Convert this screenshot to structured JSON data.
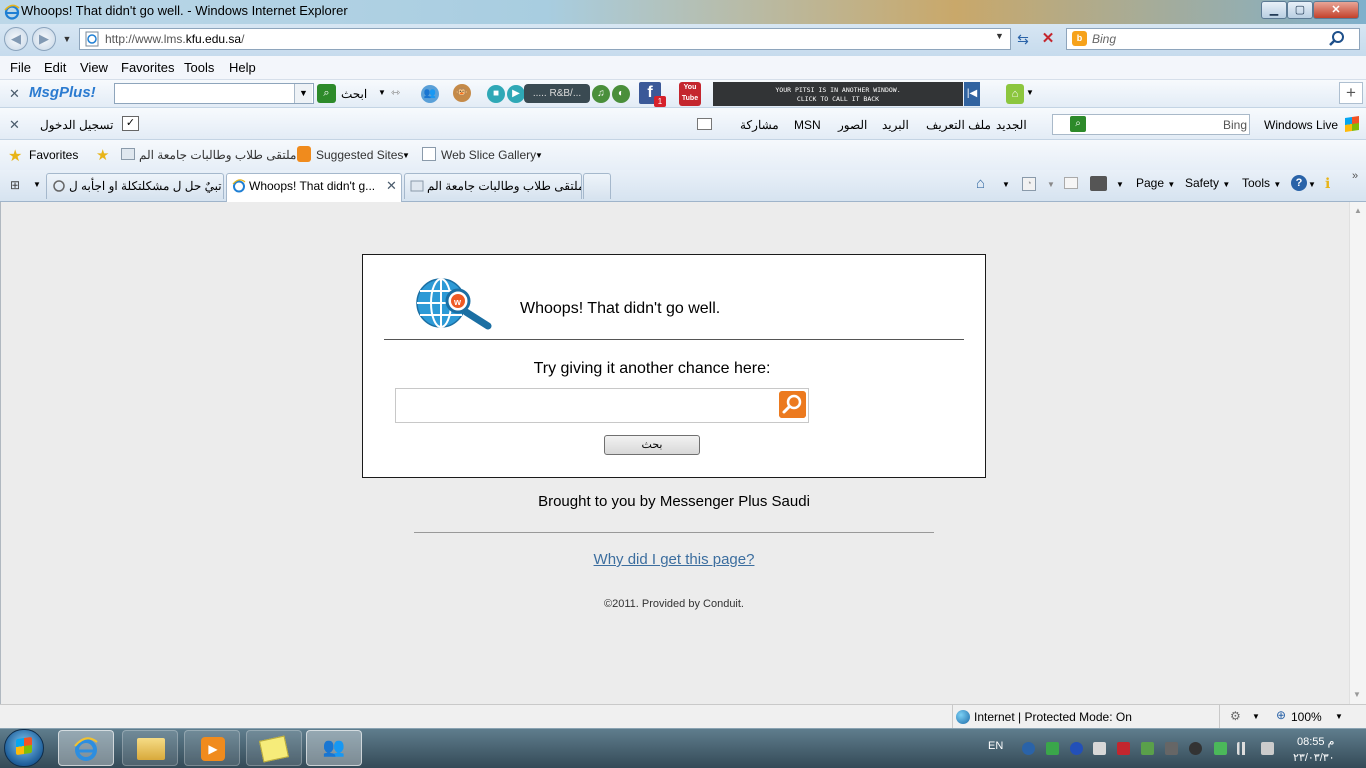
{
  "window": {
    "title": "Whoops! That didn't go well. - Windows Internet Explorer"
  },
  "address": {
    "prefix": "http://www.lms.",
    "domain": "kfu.edu.sa",
    "suffix": "/"
  },
  "search": {
    "placeholder": "Bing"
  },
  "menu": {
    "file": "File",
    "edit": "Edit",
    "view": "View",
    "favorites": "Favorites",
    "tools": "Tools",
    "help": "Help"
  },
  "msgplus_toolbar": {
    "logo": "MsgPlus!",
    "search_label": "ابحث",
    "player_label": "..... R&B/...",
    "pitsi_line1": "YOUR PITSI IS IN ANOTHER WINDOW.",
    "pitsi_line2": "CLICK TO CALL IT BACK",
    "fb_badge": "1",
    "yt_label": "You Tube"
  },
  "live_toolbar": {
    "login": "تسجيل الدخول",
    "brand": "Windows Live",
    "search_placeholder": "Bing",
    "links": [
      "الجديد",
      "ملف التعريف",
      "البريد",
      "الصور",
      "MSN",
      "مشاركة"
    ]
  },
  "favorites_bar": {
    "label": "Favorites",
    "items": [
      "ملتقى طلاب وطالبات جامعة الم...",
      "Suggested Sites",
      "Web Slice Gallery"
    ]
  },
  "tabs": [
    {
      "label": "تبيٌ حل ل مشكلتكلة او اجأبه ل ...",
      "active": false
    },
    {
      "label": "Whoops! That didn't g...",
      "active": true
    },
    {
      "label": "ملتقى طلاب وطالبات جامعة الم...",
      "active": false
    }
  ],
  "command_bar": {
    "page": "Page",
    "safety": "Safety",
    "tools": "Tools"
  },
  "error_page": {
    "title": "Whoops! That didn't go well.",
    "retry_label": "Try giving it another chance here:",
    "input_value": "",
    "button_label": "بحث",
    "brought_by": "Brought to you by Messenger Plus Saudi",
    "why_link": "Why did I get this page?",
    "copyright": "©2011. Provided by Conduit."
  },
  "status": {
    "zone": "Internet | Protected Mode: On",
    "zoom": "100%"
  },
  "taskbar": {
    "language": "EN",
    "time": "08:55 م",
    "date": "٢٣/٠٣/٣٠"
  }
}
